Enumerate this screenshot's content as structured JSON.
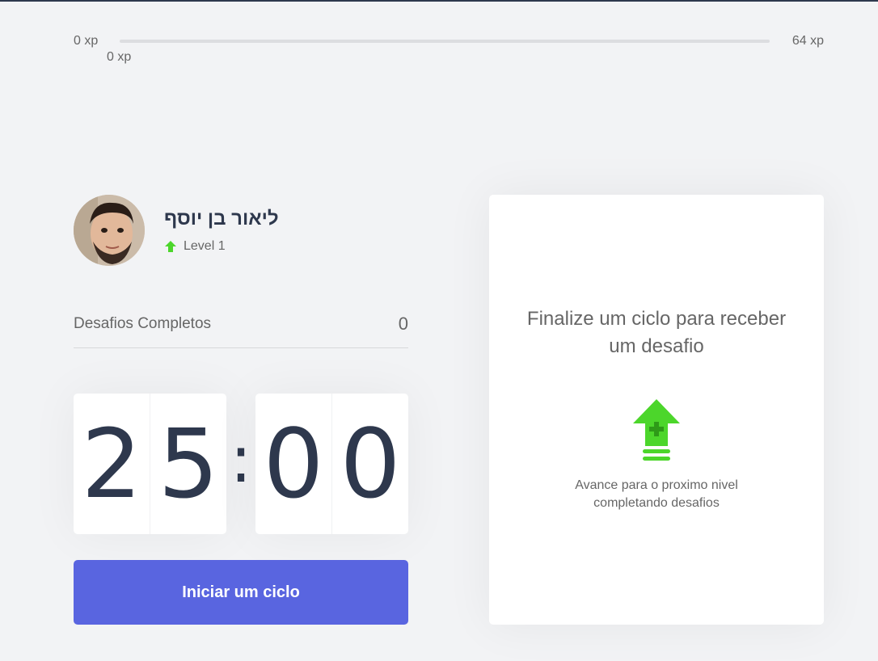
{
  "xp_bar": {
    "min_label": "0 xp",
    "max_label": "64 xp",
    "current_label": "0 xp",
    "progress_fraction": 0
  },
  "profile": {
    "name": "ליאור בן יוסף",
    "level_label": "Level 1",
    "level_icon": "level-up-arrow-icon"
  },
  "completed_challenges": {
    "label": "Desafios Completos",
    "count": "0"
  },
  "countdown": {
    "minute_left": "2",
    "minute_right": "5",
    "separator": ":",
    "second_left": "0",
    "second_right": "0"
  },
  "start_button": {
    "label": "Iniciar um ciclo"
  },
  "challenge_box": {
    "title": "Finalize um ciclo para receber um desafio",
    "icon": "level-up-icon",
    "hint": "Avance para o proximo nivel completando desafios"
  },
  "colors": {
    "accent": "#5965e0",
    "green": "#4cd62b",
    "title": "#2e384d",
    "text": "#666666",
    "background": "#f2f3f5"
  }
}
